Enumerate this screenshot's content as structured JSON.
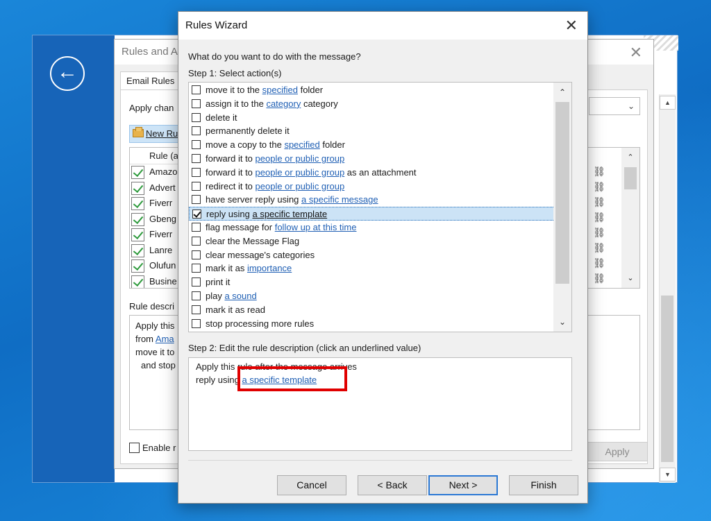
{
  "outlook": {
    "back_icon": "arrow-left-icon",
    "scroll_up_glyph": "▲",
    "scroll_down_glyph": "▼"
  },
  "rules_alerts": {
    "title": "Rules and A",
    "close_glyph": "✕",
    "tab_label": "Email Rules",
    "apply_changes_label": "Apply chan",
    "new_rule_label": "New Ru",
    "list_header": "Rule (a",
    "rules": [
      {
        "name": "Amazo",
        "enabled": true
      },
      {
        "name": "Advert",
        "enabled": true
      },
      {
        "name": "Fiverr",
        "enabled": true
      },
      {
        "name": "Gbeng",
        "enabled": true
      },
      {
        "name": "Fiverr",
        "enabled": true
      },
      {
        "name": "Lanre",
        "enabled": true
      },
      {
        "name": "Olufun",
        "enabled": true
      },
      {
        "name": "Busine",
        "enabled": true
      }
    ],
    "chain_glyph": "⛓",
    "desc_label": "Rule descri",
    "desc_lines": [
      "Apply this",
      "from ",
      "Ama",
      "move it to",
      "and stop"
    ],
    "enable_label": "Enable r",
    "apply_button": "Apply"
  },
  "wizard": {
    "title": "Rules Wizard",
    "close_glyph": "✕",
    "question": "What do you want to do with the message?",
    "step1_label": "Step 1: Select action(s)",
    "actions": [
      {
        "before": "move it to the ",
        "link": "specified",
        "after": " folder",
        "checked": false
      },
      {
        "before": "assign it to the ",
        "link": "category",
        "after": " category",
        "checked": false
      },
      {
        "before": "delete it",
        "link": "",
        "after": "",
        "checked": false
      },
      {
        "before": "permanently delete it",
        "link": "",
        "after": "",
        "checked": false
      },
      {
        "before": "move a copy to the ",
        "link": "specified",
        "after": " folder",
        "checked": false
      },
      {
        "before": "forward it to ",
        "link": "people or public group",
        "after": "",
        "checked": false
      },
      {
        "before": "forward it to ",
        "link": "people or public group",
        "after": " as an attachment",
        "checked": false
      },
      {
        "before": "redirect it to ",
        "link": "people or public group",
        "after": "",
        "checked": false
      },
      {
        "before": "have server reply using ",
        "link": "a specific message",
        "after": "",
        "checked": false
      },
      {
        "before": "reply using ",
        "link": "a specific template",
        "after": "",
        "checked": true
      },
      {
        "before": "flag message for ",
        "link": "follow up at this time",
        "after": "",
        "checked": false
      },
      {
        "before": "clear the Message Flag",
        "link": "",
        "after": "",
        "checked": false
      },
      {
        "before": "clear message's categories",
        "link": "",
        "after": "",
        "checked": false
      },
      {
        "before": "mark it as ",
        "link": "importance",
        "after": "",
        "checked": false
      },
      {
        "before": "print it",
        "link": "",
        "after": "",
        "checked": false
      },
      {
        "before": "play ",
        "link": "a sound",
        "after": "",
        "checked": false
      },
      {
        "before": "mark it as read",
        "link": "",
        "after": "",
        "checked": false
      },
      {
        "before": "stop processing more rules",
        "link": "",
        "after": "",
        "checked": false
      }
    ],
    "scroll_up_glyph": "⌃",
    "scroll_down_glyph": "⌄",
    "step2_label": "Step 2: Edit the rule description (click an underlined value)",
    "desc_line1": "Apply this rule after the message arrives",
    "desc_line2_prefix": "reply using ",
    "desc_line2_link": "a specific template",
    "buttons": {
      "cancel": "Cancel",
      "back": "< Back",
      "next": "Next >",
      "finish": "Finish"
    },
    "highlight_color": "#e00000"
  }
}
